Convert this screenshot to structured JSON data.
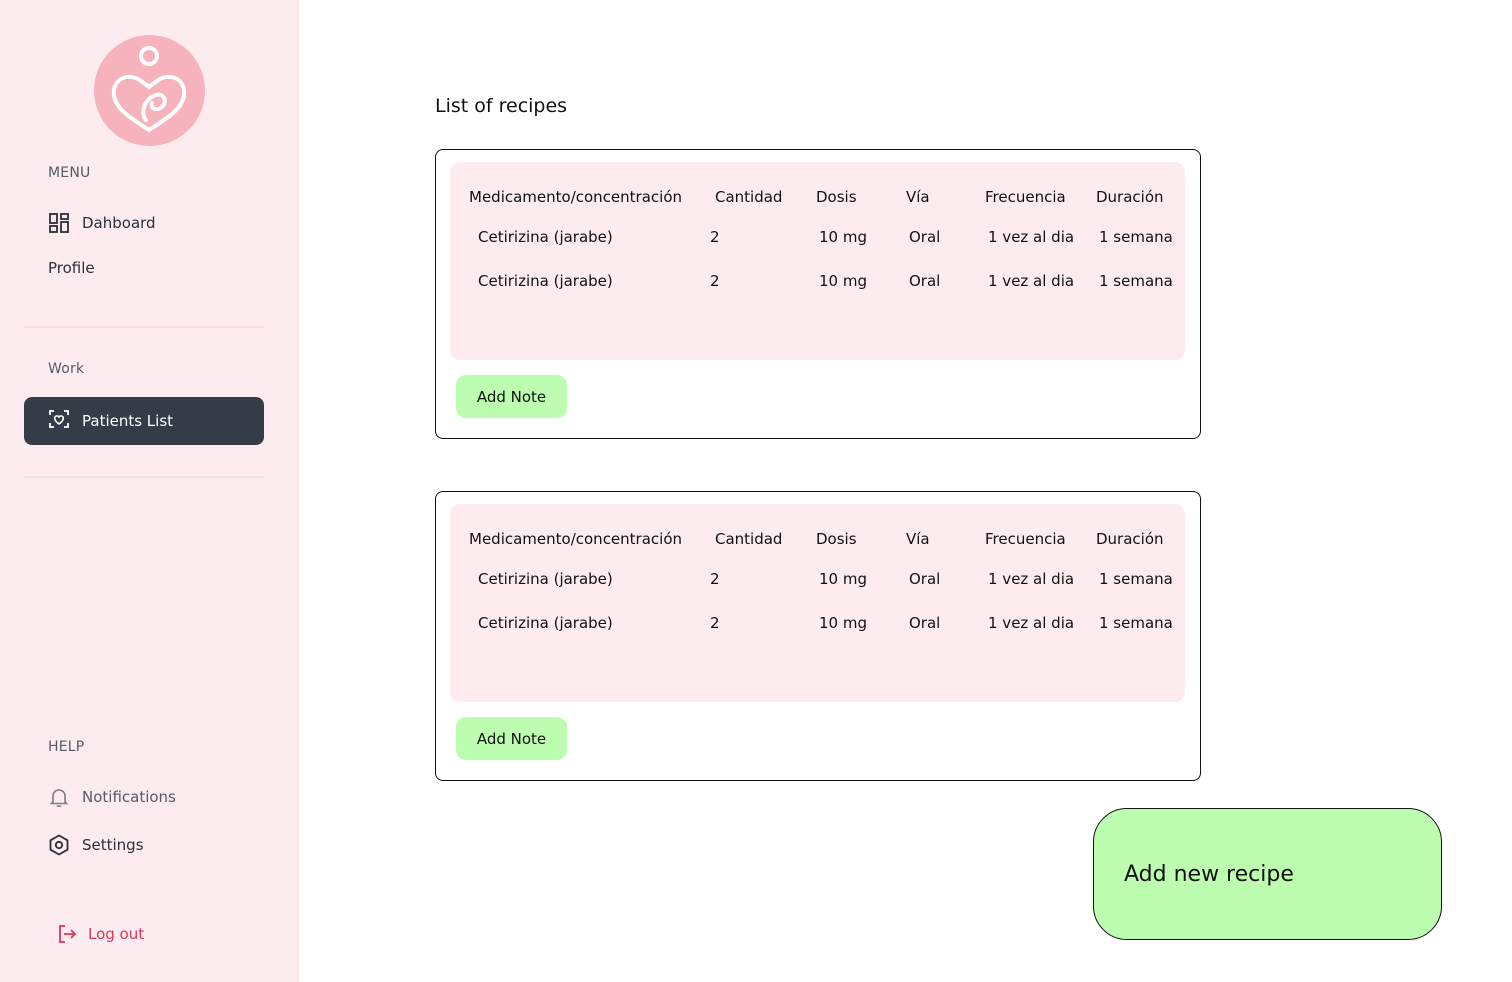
{
  "sidebar": {
    "menu_label": "MENU",
    "menu_items": [
      {
        "label": "Dahboard",
        "icon": "dashboard-icon"
      },
      {
        "label": "Profile",
        "icon": ""
      }
    ],
    "work_label": "Work",
    "work_items": [
      {
        "label": "Patients List",
        "icon": "patient-scan-icon",
        "active": true
      }
    ],
    "help_label": "HELP",
    "help_items": [
      {
        "label": "Notifications",
        "icon": "bell-icon"
      },
      {
        "label": "Settings",
        "icon": "settings-hexagon-icon"
      }
    ],
    "logout_label": "Log out",
    "logo_icon": "mother-baby-logo"
  },
  "main": {
    "title": "List of recipes",
    "columns": [
      "Medicamento/concentración",
      "Cantidad",
      "Dosis",
      "Vía",
      "Frecuencia",
      "Duración"
    ],
    "recipes": [
      {
        "rows": [
          [
            "Cetirizina (jarabe)",
            "2",
            "10 mg",
            "Oral",
            "1 vez al dia",
            "1 semana"
          ],
          [
            "Cetirizina (jarabe)",
            "2",
            "10 mg",
            "Oral",
            "1 vez al dia",
            "1 semana"
          ]
        ],
        "add_note_label": "Add Note"
      },
      {
        "rows": [
          [
            "Cetirizina (jarabe)",
            "2",
            "10 mg",
            "Oral",
            "1 vez al dia",
            "1 semana"
          ],
          [
            "Cetirizina (jarabe)",
            "2",
            "10 mg",
            "Oral",
            "1 vez al dia",
            "1 semana"
          ]
        ],
        "add_note_label": "Add Note"
      }
    ],
    "add_recipe_label": "Add new recipe"
  },
  "colors": {
    "sidebar_bg": "#fdecef",
    "active_bg": "#343d47",
    "accent_green": "#bdfdb0",
    "logout_red": "#e0355a",
    "logo_pink": "#f6b2bd"
  }
}
